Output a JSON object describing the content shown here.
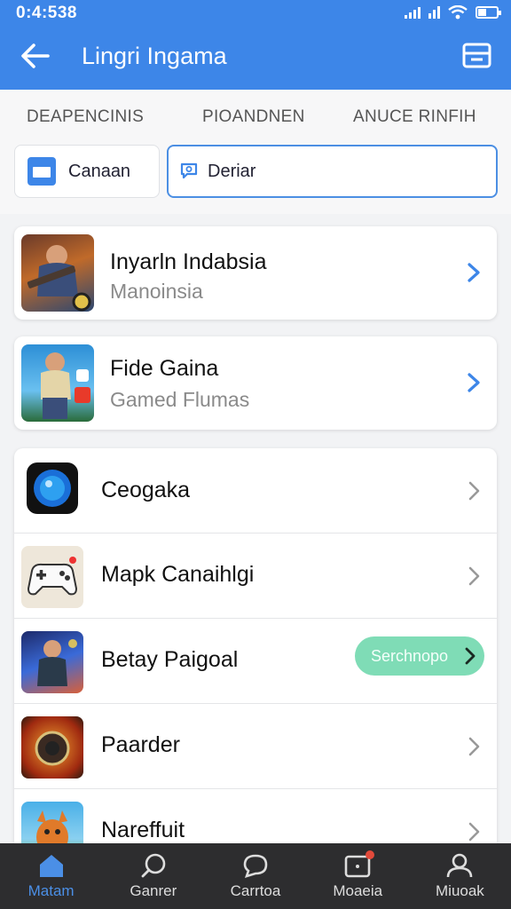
{
  "status_bar": {
    "time": "0:4:538"
  },
  "header": {
    "title": "Lingri Ingama",
    "accent": "#3d86e8"
  },
  "filter_tabs": [
    {
      "label": "DEAPENCINIS"
    },
    {
      "label": "PIOANDNEN"
    },
    {
      "label": "ANUCE RINFIH"
    }
  ],
  "chips": {
    "calendar": {
      "label": "Canaan",
      "icon": "calendar-icon"
    },
    "search": {
      "label": "Deriar",
      "icon": "search-chat-icon"
    }
  },
  "featured": [
    {
      "title": "Inyarln Indabsia",
      "subtitle": "Manoinsia"
    },
    {
      "title": "Fide Gaina",
      "subtitle": "Gamed Flumas"
    }
  ],
  "list": [
    {
      "label": "Ceogaka",
      "icon": "camera-app-icon"
    },
    {
      "label": "Mapk Canaihlgi",
      "icon": "gamepad-icon"
    },
    {
      "label": "Betay Paigoal",
      "icon": "game-character-icon",
      "action": "Serchnopo",
      "action_color": "#7fdcb6"
    },
    {
      "label": "Paarder",
      "icon": "game-emblem-icon"
    },
    {
      "label": "Nareffuit",
      "icon": "cartoon-fox-icon"
    }
  ],
  "bottom_nav": [
    {
      "label": "Matam",
      "icon": "home-icon",
      "active": true
    },
    {
      "label": "Ganrer",
      "icon": "search-icon"
    },
    {
      "label": "Carrtoa",
      "icon": "chat-icon"
    },
    {
      "label": "Moaeia",
      "icon": "inbox-icon",
      "badge": true
    },
    {
      "label": "Miuoak",
      "icon": "profile-icon"
    }
  ]
}
